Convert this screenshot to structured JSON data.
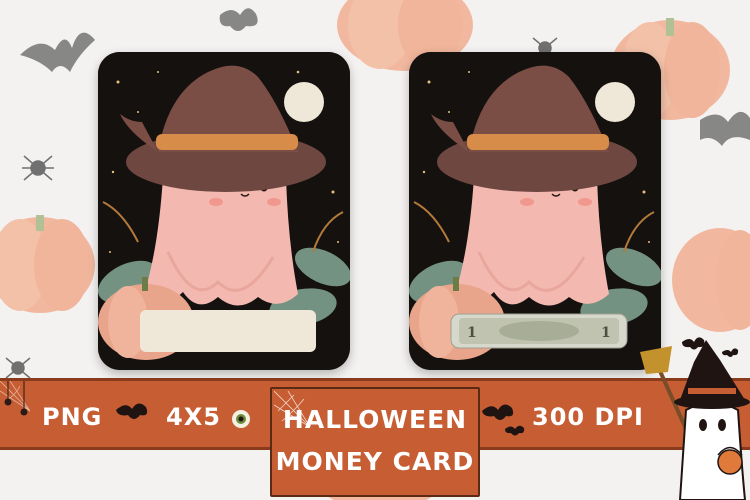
{
  "banner": {
    "left_format": "PNG",
    "left_size": "4X5",
    "title_line1": "HALLOWEEN",
    "title_line2": "MONEY CARD",
    "right_resolution": "300 DPI"
  },
  "money": {
    "denomination": "1"
  },
  "colors": {
    "banner": "#c65d33",
    "card_bg": "#14110f",
    "ghost": "#f3b9b0",
    "hat": "#7a4d45",
    "hat_band": "#d88c4a",
    "pumpkin": "#e9a58c",
    "slot": "#efe7d8"
  }
}
